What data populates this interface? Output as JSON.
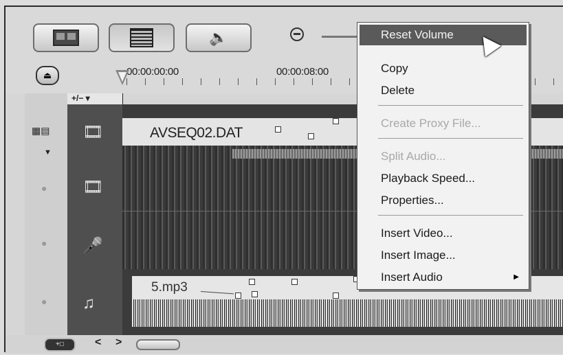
{
  "toolbar": {
    "buttons": [
      {
        "icon": "storyboard-view-icon"
      },
      {
        "icon": "timeline-view-icon"
      },
      {
        "icon": "audio-view-icon"
      }
    ],
    "zoom_icon": "zoom-out-icon"
  },
  "ruler": {
    "timecodes": [
      "00:00:00:00",
      "00:00:08:00"
    ]
  },
  "track_controls": {
    "add_remove_label": "+/− ▾"
  },
  "tracks": {
    "video_clip_name": "AVSEQ02.DAT",
    "audio_clip_name": "5.mp3"
  },
  "context_menu": {
    "items": [
      {
        "label": "Reset Volume",
        "state": "highlighted"
      },
      {
        "label": "Copy",
        "state": "enabled"
      },
      {
        "label": "Delete",
        "state": "enabled"
      },
      {
        "label": "Create Proxy File...",
        "state": "disabled"
      },
      {
        "label": "Split Audio...",
        "state": "disabled"
      },
      {
        "label": "Playback Speed...",
        "state": "enabled"
      },
      {
        "label": "Properties...",
        "state": "enabled"
      },
      {
        "label": "Insert Video...",
        "state": "enabled"
      },
      {
        "label": "Insert Image...",
        "state": "enabled"
      },
      {
        "label": "Insert Audio",
        "state": "enabled",
        "submenu": true
      }
    ]
  },
  "bottom": {
    "nav_prev": "<",
    "nav_next": ">"
  }
}
